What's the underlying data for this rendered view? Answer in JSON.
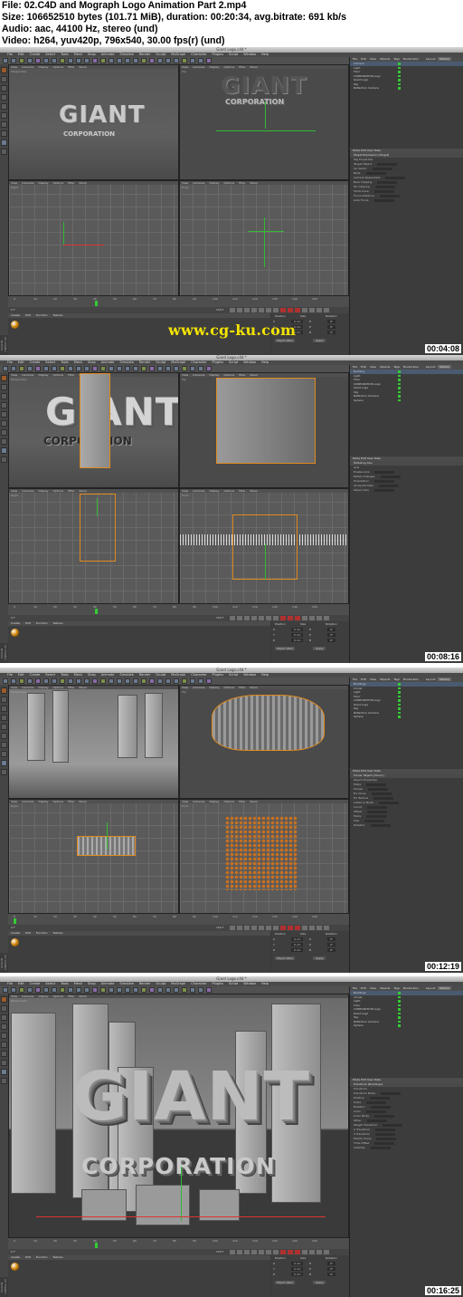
{
  "info": {
    "line1": "File: 02.C4D and Mograph Logo Animation Part 2.mp4",
    "line2": "Size: 106652510 bytes (101.71 MiB), duration: 00:20:34, avg.bitrate: 691 kb/s",
    "line3": "Audio: aac, 44100 Hz, stereo (und)",
    "line4": "Video: h264, yuv420p, 796x540, 30.00 fps(r) (und)"
  },
  "window_title": "Giant Logo.c4d *",
  "menus": [
    "File",
    "Edit",
    "Create",
    "Select",
    "Tools",
    "Mesh",
    "Snap",
    "Animate",
    "Simulate",
    "Render",
    "Sculpt",
    "MoGraph",
    "Character",
    "Plugins",
    "Script",
    "Window",
    "Help"
  ],
  "viewport_menu": [
    "View",
    "Cameras",
    "Display",
    "Options",
    "Filter",
    "Panel"
  ],
  "viewport_names": [
    "Perspective",
    "Top",
    "Right",
    "Front"
  ],
  "object_manager": {
    "tabs": [
      "File",
      "Edit",
      "View",
      "Objects",
      "Tags",
      "Bookmarks"
    ],
    "layout_label": "Layout:",
    "layout_value": "Startup"
  },
  "objects_frame1": [
    "Camera",
    "Light",
    "Floor",
    "CORPORATION Logo",
    "Giant Logo",
    "Sky",
    "Reflection Camera"
  ],
  "objects_frame2": [
    "Building",
    "Light",
    "Floor",
    "CORPORATION Logo",
    "Giant Logo",
    "Sky",
    "Reflection Camera",
    "Sphere"
  ],
  "objects_frame3": [
    "Buildings",
    "Cloner",
    "Light",
    "Floor",
    "CORPORATION Logo",
    "Giant Logo",
    "Sky",
    "Reflection Camera",
    "Sphere"
  ],
  "objects_frame4": [
    "Buildings",
    "Cloner",
    "Light",
    "Floor",
    "CORPORATION Logo",
    "Giant Logo",
    "Sky",
    "Reflection Camera",
    "Sphere"
  ],
  "attr_frame1": {
    "title": "Mode  Edit  User Data",
    "header": "Target Expression [Target]",
    "rows": [
      "Tag Properties",
      "Target Object",
      "Up Vector",
      "Bank",
      "Camera Dependent",
      "Near Clipping",
      "Far Clipping",
      "Show Cone",
      "Focus Distance",
      "Auto Focus"
    ]
  },
  "attr_frame2": {
    "title": "Mode  Edit  User Data",
    "header": "Modeling Axis",
    "rows": [
      "Axis",
      "Enable Axis",
      "Retain Changes",
      "Orientation",
      "Along Normals",
      "Object Axis"
    ]
  },
  "attr_frame3": {
    "title": "Mode  Edit  User Data",
    "header": "Cloner Object [Cloner]",
    "rows": [
      "Object Properties",
      "Mode",
      "Clones",
      "Fix Clone",
      "Fix Texture",
      "Instance Mode",
      "Count",
      "Offset",
      "Mode",
      "Size",
      "Rotation"
    ]
  },
  "attr_frame4": {
    "title": "Mode  Edit  User Data",
    "header": "Transform [Buildings]",
    "rows": [
      "Transform",
      "Transform Mode",
      "Position",
      "Scale",
      "Rotation",
      "Color",
      "Color Mode",
      "Other",
      "Weight Transform",
      "U Transform",
      "V Transform",
      "Modify Clone",
      "Time Offset",
      "Visibility"
    ]
  },
  "timeline": {
    "ticks": [
      "0",
      "10",
      "20",
      "30",
      "40",
      "50",
      "60",
      "70",
      "80",
      "90",
      "100",
      "110",
      "120",
      "130",
      "140",
      "150"
    ],
    "start": "0 F",
    "end": "150 F",
    "current": "0 F"
  },
  "material_tabs": [
    "Create",
    "Edit",
    "Function",
    "Texture"
  ],
  "coords": {
    "headers": [
      "Position",
      "Size",
      "Rotation"
    ],
    "rows": [
      [
        "X",
        "0 cm",
        "H",
        "0°"
      ],
      [
        "Y",
        "0 cm",
        "P",
        "0°"
      ],
      [
        "Z",
        "0 cm",
        "B",
        "0°"
      ]
    ],
    "mode": "Object (Rel)",
    "apply": "Apply"
  },
  "logo_text": {
    "main": "GIANT",
    "sub": "CORPORATION"
  },
  "timestamps": [
    "00:04:08",
    "00:08:16",
    "00:12:19",
    "00:16:25"
  ],
  "watermark": "www.cg-ku.com",
  "app_side_label": "MAXON CINEMA 4D",
  "colors": {
    "selection_orange": "#e08a20",
    "axis_green": "#33bb33",
    "axis_red": "#dd3333",
    "watermark_yellow": "#f2e300",
    "ui_dark": "#3a3a3a"
  }
}
